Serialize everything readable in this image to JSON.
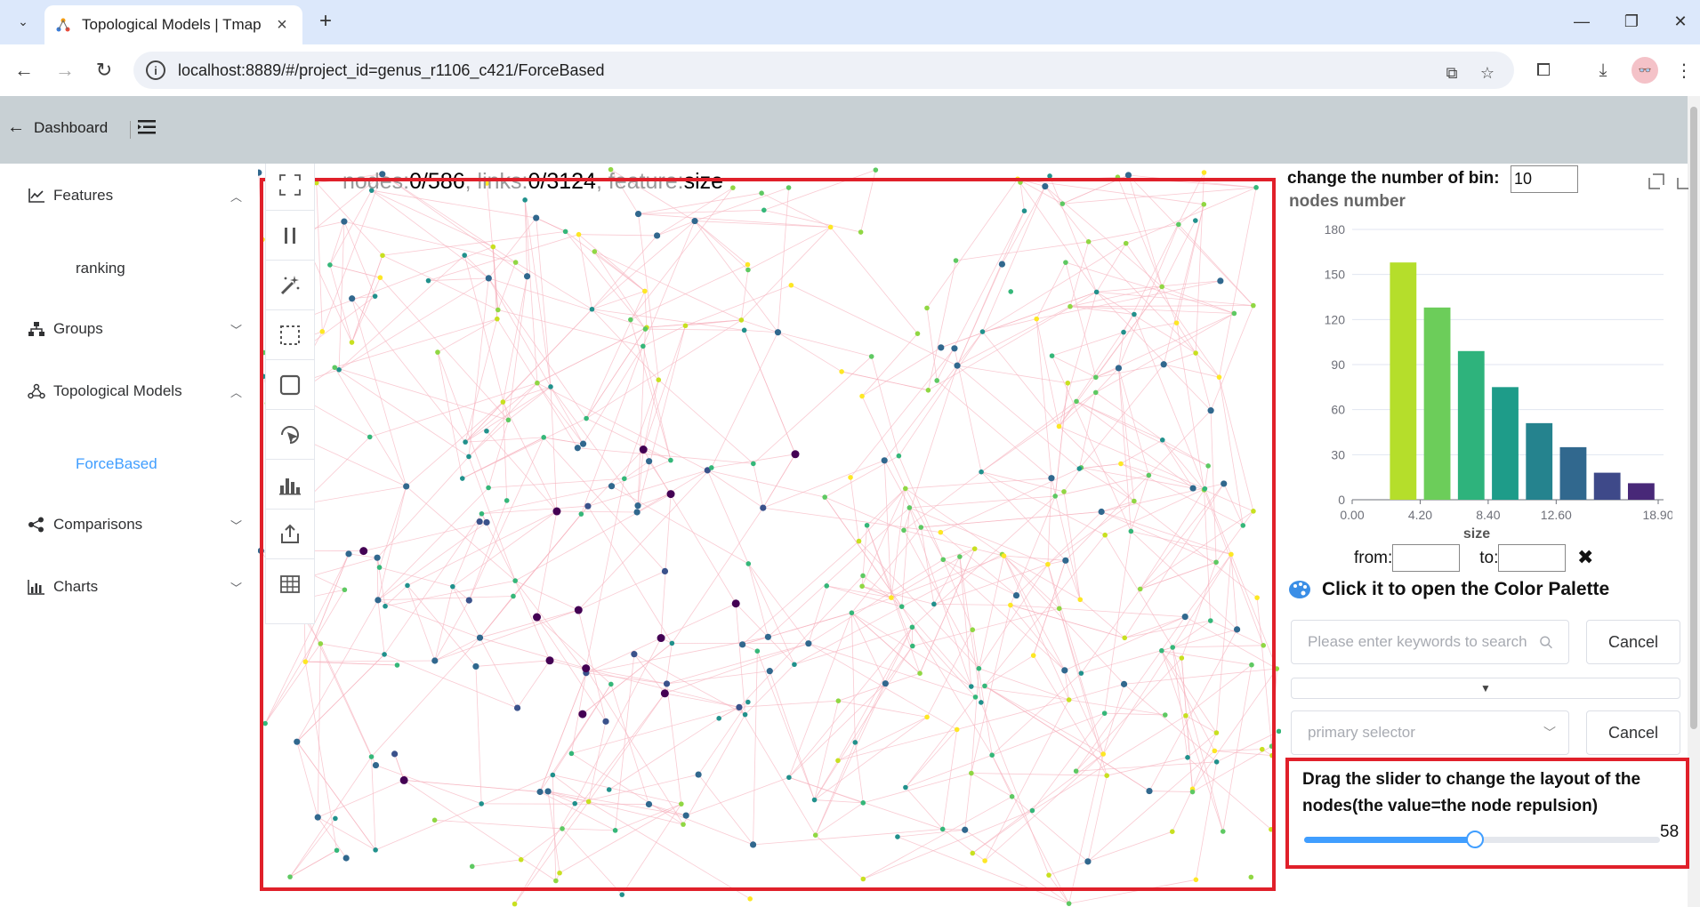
{
  "browser": {
    "tab_title": "Topological Models | Tmap",
    "url": "localhost:8889/#/project_id=genus_r1106_c421/ForceBased"
  },
  "header": {
    "back_label": "Dashboard"
  },
  "sidebar": {
    "items": [
      {
        "label": "Features",
        "icon": "line-chart-icon",
        "expanded": true
      },
      {
        "label": "Groups",
        "icon": "hierarchy-icon",
        "expanded": false
      },
      {
        "label": "Topological Models",
        "icon": "topology-icon",
        "expanded": true
      },
      {
        "label": "Comparisons",
        "icon": "share-nodes-icon",
        "expanded": false
      },
      {
        "label": "Charts",
        "icon": "bar-chart-icon",
        "expanded": false
      }
    ],
    "subitems": {
      "features": "ranking",
      "topological": "ForceBased"
    }
  },
  "graph": {
    "nodes_label": "nodes:",
    "nodes_value": "0/586",
    "links_label": ", links:",
    "links_value": "0/3124",
    "feature_label": ", feature:",
    "feature_value": "size"
  },
  "toolbar_icons": [
    "fullscreen-icon",
    "pause-icon",
    "magic-wand-icon",
    "lasso-select-icon",
    "square-select-icon",
    "pointer-select-icon",
    "histogram-icon",
    "export-icon",
    "table-icon"
  ],
  "panel": {
    "bins_label": "change the number of bin:",
    "bins_value": "10",
    "palette_label": "Click it to open the Color Palette",
    "search_placeholder": "Please enter keywords to search",
    "cancel_label": "Cancel",
    "collapse_arrow": "▼",
    "selector_placeholder": "primary selector",
    "from_label": "from:",
    "to_label": "to:",
    "clear_icon": "✖",
    "slider_label": "Drag the slider to change the layout of the nodes(the value=the node repulsion)",
    "slider_value": "58",
    "slider_fraction": 0.48
  },
  "chart_data": {
    "type": "bar",
    "title": "nodes number",
    "xlabel": "size",
    "ylabel": "",
    "ylim": [
      0,
      180
    ],
    "yticks": [
      "0",
      "30",
      "60",
      "90",
      "120",
      "150",
      "180"
    ],
    "xticks": [
      "0.00",
      "4.20",
      "8.40",
      "12.60",
      "18.90"
    ],
    "bin_edges": [
      0,
      2.1,
      4.2,
      6.3,
      8.4,
      10.5,
      12.6,
      14.7,
      16.8,
      18.9
    ],
    "values": [
      0,
      158,
      128,
      99,
      75,
      51,
      35,
      18,
      11,
      2
    ],
    "colors": [
      "#bddf26",
      "#b5de2b",
      "#6ccd5a",
      "#2eb37c",
      "#1e9c89",
      "#25838e",
      "#31688e",
      "#3e4989",
      "#482878",
      "#440154"
    ]
  }
}
